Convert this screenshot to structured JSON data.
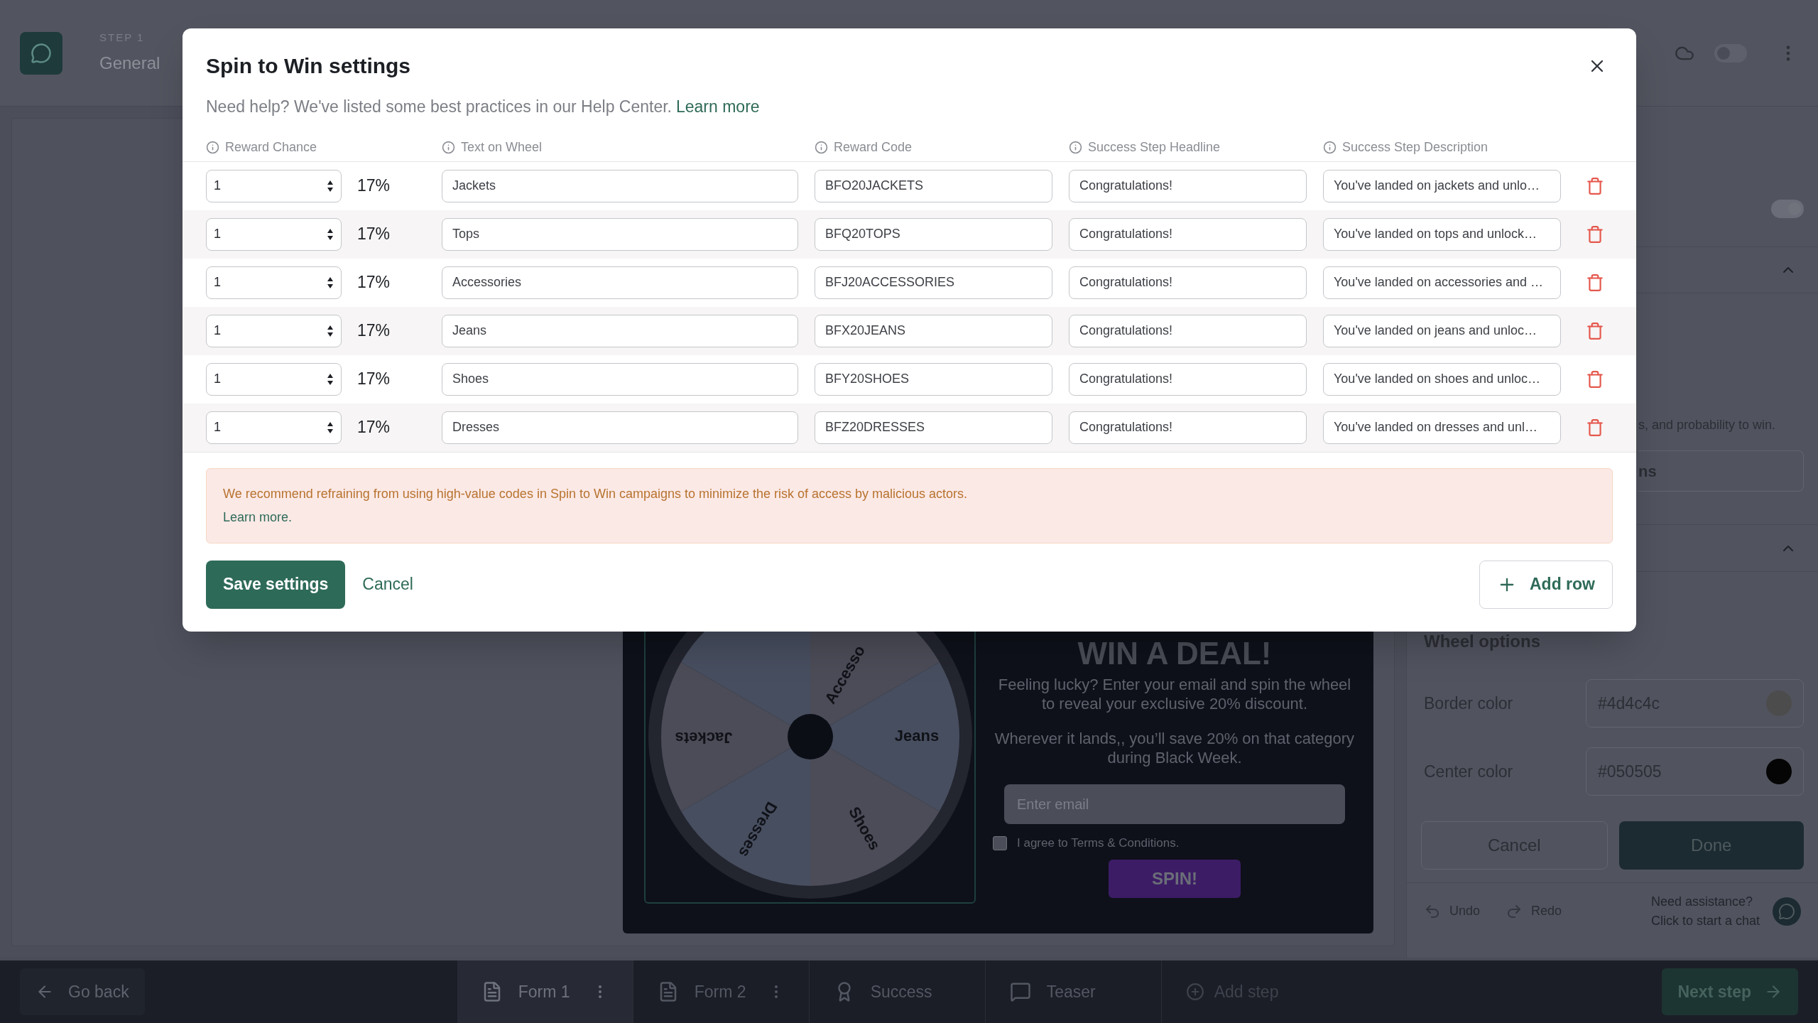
{
  "header": {
    "step_label": "STEP 1",
    "step_name": "General",
    "sync_toggle_on": false
  },
  "modal": {
    "title": "Spin to Win settings",
    "help_text": "Need help? We've listed some best practices in our Help Center.",
    "help_link": "Learn more",
    "columns": [
      "Reward Chance",
      "Text on Wheel",
      "Reward Code",
      "Success Step Headline",
      "Success Step Description"
    ],
    "rows": [
      {
        "chance": "1",
        "percent": "17%",
        "text": "Jackets",
        "code": "BFO20JACKETS",
        "headline": "Congratulations!",
        "description": "You've landed on jackets and unlo…"
      },
      {
        "chance": "1",
        "percent": "17%",
        "text": "Tops",
        "code": "BFQ20TOPS",
        "headline": "Congratulations!",
        "description": "You've landed on tops and unlock…"
      },
      {
        "chance": "1",
        "percent": "17%",
        "text": "Accessories",
        "code": "BFJ20ACCESSORIES",
        "headline": "Congratulations!",
        "description": "You've landed on accessories and …"
      },
      {
        "chance": "1",
        "percent": "17%",
        "text": "Jeans",
        "code": "BFX20JEANS",
        "headline": "Congratulations!",
        "description": "You've landed on jeans and unloc…"
      },
      {
        "chance": "1",
        "percent": "17%",
        "text": "Shoes",
        "code": "BFY20SHOES",
        "headline": "Congratulations!",
        "description": "You've landed on shoes and unloc…"
      },
      {
        "chance": "1",
        "percent": "17%",
        "text": "Dresses",
        "code": "BFZ20DRESSES",
        "headline": "Congratulations!",
        "description": "You've landed on dresses and unl…"
      }
    ],
    "warning": {
      "text": "We recommend refraining from using high-value codes in Spin to Win campaigns to minimize the risk of access by malicious actors.",
      "link": "Learn more."
    },
    "save_button": "Save settings",
    "cancel_button": "Cancel",
    "add_row_button": "Add row"
  },
  "preview": {
    "headline": "WIN A DEAL!",
    "wheel_labels": [
      "Jackets",
      "Accesso",
      "Jeans",
      "Shoes",
      "Dresses"
    ],
    "paragraphs": [
      "Feeling lucky? Enter your email and spin the wheel to reveal your exclusive 20% discount.",
      "Wherever it lands,, you’ll save 20% on that category during Black Week."
    ],
    "email_placeholder": "Enter email",
    "terms": {
      "label": "I agree to Terms & Conditions.",
      "checked": false
    },
    "spin_button": "SPIN!"
  },
  "panel": {
    "toggle_on": true,
    "partial_text": "s, and probability to win.",
    "partial_button": "ns",
    "section_title": "Wheel options",
    "fields": [
      {
        "label": "Border color",
        "value": "#4d4c4c",
        "color": "#4d4c4c"
      },
      {
        "label": "Center color",
        "value": "#050505",
        "color": "#050505"
      }
    ],
    "cancel_button": "Cancel",
    "done_button": "Done",
    "undo": "Undo",
    "redo": "Redo",
    "help_title": "Need assistance?",
    "help_subtitle": "Click to start a chat"
  },
  "footer": {
    "back_button": "Go back",
    "steps": [
      {
        "label": "Form 1",
        "kind": "form",
        "selected": true
      },
      {
        "label": "Form 2",
        "kind": "form",
        "selected": false
      },
      {
        "label": "Success",
        "kind": "success",
        "selected": false
      },
      {
        "label": "Teaser",
        "kind": "teaser",
        "selected": false
      }
    ],
    "add_step": "Add step",
    "next_button": "Next step"
  }
}
